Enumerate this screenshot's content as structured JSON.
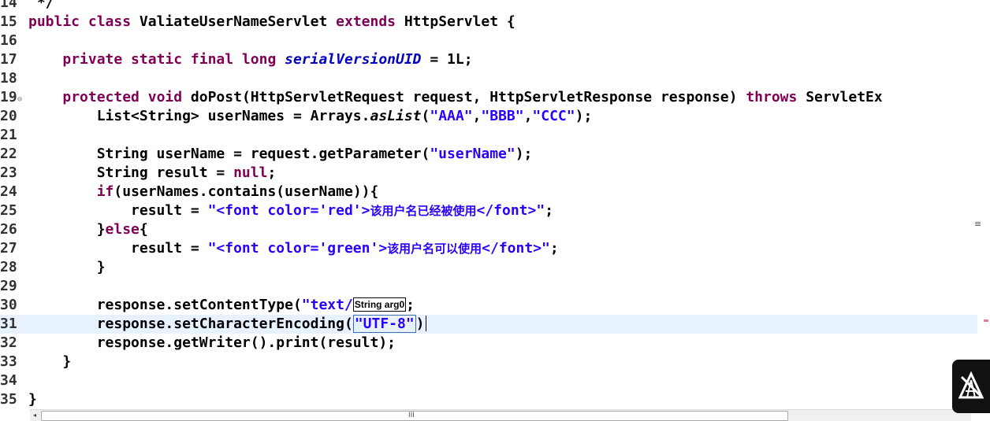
{
  "editor": {
    "lines": [
      {
        "number": "14",
        "segments": [
          {
            "text": " */",
            "style": "plain"
          }
        ]
      },
      {
        "number": "15",
        "segments": [
          {
            "text": "public class ",
            "style": "kw"
          },
          {
            "text": "ValiateUserNameServlet ",
            "style": "plain"
          },
          {
            "text": "extends ",
            "style": "kw"
          },
          {
            "text": "HttpServlet {",
            "style": "plain"
          }
        ]
      },
      {
        "number": "16",
        "segments": []
      },
      {
        "number": "17",
        "segments": [
          {
            "text": "    ",
            "style": "plain"
          },
          {
            "text": "private static final long ",
            "style": "kw"
          },
          {
            "text": "serialVersionUID",
            "style": "static-field"
          },
          {
            "text": " = 1L;",
            "style": "plain"
          }
        ]
      },
      {
        "number": "18",
        "segments": []
      },
      {
        "number": "19",
        "fold": "⊖",
        "segments": [
          {
            "text": "    ",
            "style": "plain"
          },
          {
            "text": "protected void ",
            "style": "kw"
          },
          {
            "text": "doPost(HttpServletRequest request, HttpServletResponse response) ",
            "style": "plain"
          },
          {
            "text": "throws ",
            "style": "kw"
          },
          {
            "text": "ServletEx",
            "style": "plain"
          }
        ]
      },
      {
        "number": "20",
        "segments": [
          {
            "text": "        List<String> userNames = Arrays.",
            "style": "plain"
          },
          {
            "text": "asList",
            "style": "static-call"
          },
          {
            "text": "(",
            "style": "plain"
          },
          {
            "text": "\"AAA\"",
            "style": "str"
          },
          {
            "text": ",",
            "style": "plain"
          },
          {
            "text": "\"BBB\"",
            "style": "str"
          },
          {
            "text": ",",
            "style": "plain"
          },
          {
            "text": "\"CCC\"",
            "style": "str"
          },
          {
            "text": ");",
            "style": "plain"
          }
        ]
      },
      {
        "number": "21",
        "segments": []
      },
      {
        "number": "22",
        "segments": [
          {
            "text": "        String userName = request.getParameter(",
            "style": "plain"
          },
          {
            "text": "\"userName\"",
            "style": "str"
          },
          {
            "text": ");",
            "style": "plain"
          }
        ]
      },
      {
        "number": "23",
        "segments": [
          {
            "text": "        String result = ",
            "style": "plain"
          },
          {
            "text": "null",
            "style": "kw"
          },
          {
            "text": ";",
            "style": "plain"
          }
        ]
      },
      {
        "number": "24",
        "segments": [
          {
            "text": "        ",
            "style": "plain"
          },
          {
            "text": "if",
            "style": "kw"
          },
          {
            "text": "(userNames.contains(userName)){",
            "style": "plain"
          }
        ]
      },
      {
        "number": "25",
        "segments": [
          {
            "text": "            result = ",
            "style": "plain"
          },
          {
            "text": "\"<font color='red'>",
            "style": "str"
          },
          {
            "text": "该用户名已经被使用",
            "style": "str cn"
          },
          {
            "text": "</font>\"",
            "style": "str"
          },
          {
            "text": ";",
            "style": "plain"
          }
        ]
      },
      {
        "number": "26",
        "segments": [
          {
            "text": "        }",
            "style": "plain"
          },
          {
            "text": "else",
            "style": "kw"
          },
          {
            "text": "{",
            "style": "plain"
          }
        ]
      },
      {
        "number": "27",
        "segments": [
          {
            "text": "            result = ",
            "style": "plain"
          },
          {
            "text": "\"<font color='green'>",
            "style": "str"
          },
          {
            "text": "该用户名可以使用",
            "style": "str cn"
          },
          {
            "text": "</font>\"",
            "style": "str"
          },
          {
            "text": ";",
            "style": "plain"
          }
        ]
      },
      {
        "number": "28",
        "segments": [
          {
            "text": "        }",
            "style": "plain"
          }
        ]
      },
      {
        "number": "29",
        "segments": []
      },
      {
        "number": "30",
        "segments": [
          {
            "text": "        response.setContentType(",
            "style": "plain"
          },
          {
            "text": "\"text/",
            "style": "str"
          },
          {
            "text": "String arg0",
            "style": "hint"
          },
          {
            "text": ";",
            "style": "plain"
          }
        ]
      },
      {
        "number": "31",
        "current": true,
        "segments": [
          {
            "text": "        response.setCharacterEncoding(",
            "style": "plain"
          },
          {
            "text": "\"UTF-8\"",
            "style": "str link"
          },
          {
            "text": ")",
            "style": "plain"
          },
          {
            "text": "",
            "style": "caret"
          }
        ]
      },
      {
        "number": "32",
        "segments": [
          {
            "text": "        response.getWriter().print(result);",
            "style": "plain"
          }
        ]
      },
      {
        "number": "33",
        "segments": [
          {
            "text": "    }",
            "style": "plain"
          }
        ]
      },
      {
        "number": "34",
        "segments": []
      },
      {
        "number": "35",
        "segments": [
          {
            "text": "}",
            "style": "plain"
          }
        ]
      }
    ]
  },
  "overview_ruler": {
    "mark": "≡"
  },
  "hscrollbar": {
    "left_arrow": "◂",
    "grip": "III"
  },
  "colors": {
    "keyword": "#7f0055",
    "string": "#2a00ff",
    "static_field": "#0000c0",
    "current_line": "#e8f2fe"
  },
  "icons": [
    "fold-collapse-icon",
    "scroll-left-arrow-icon",
    "watermark-logo-icon"
  ]
}
